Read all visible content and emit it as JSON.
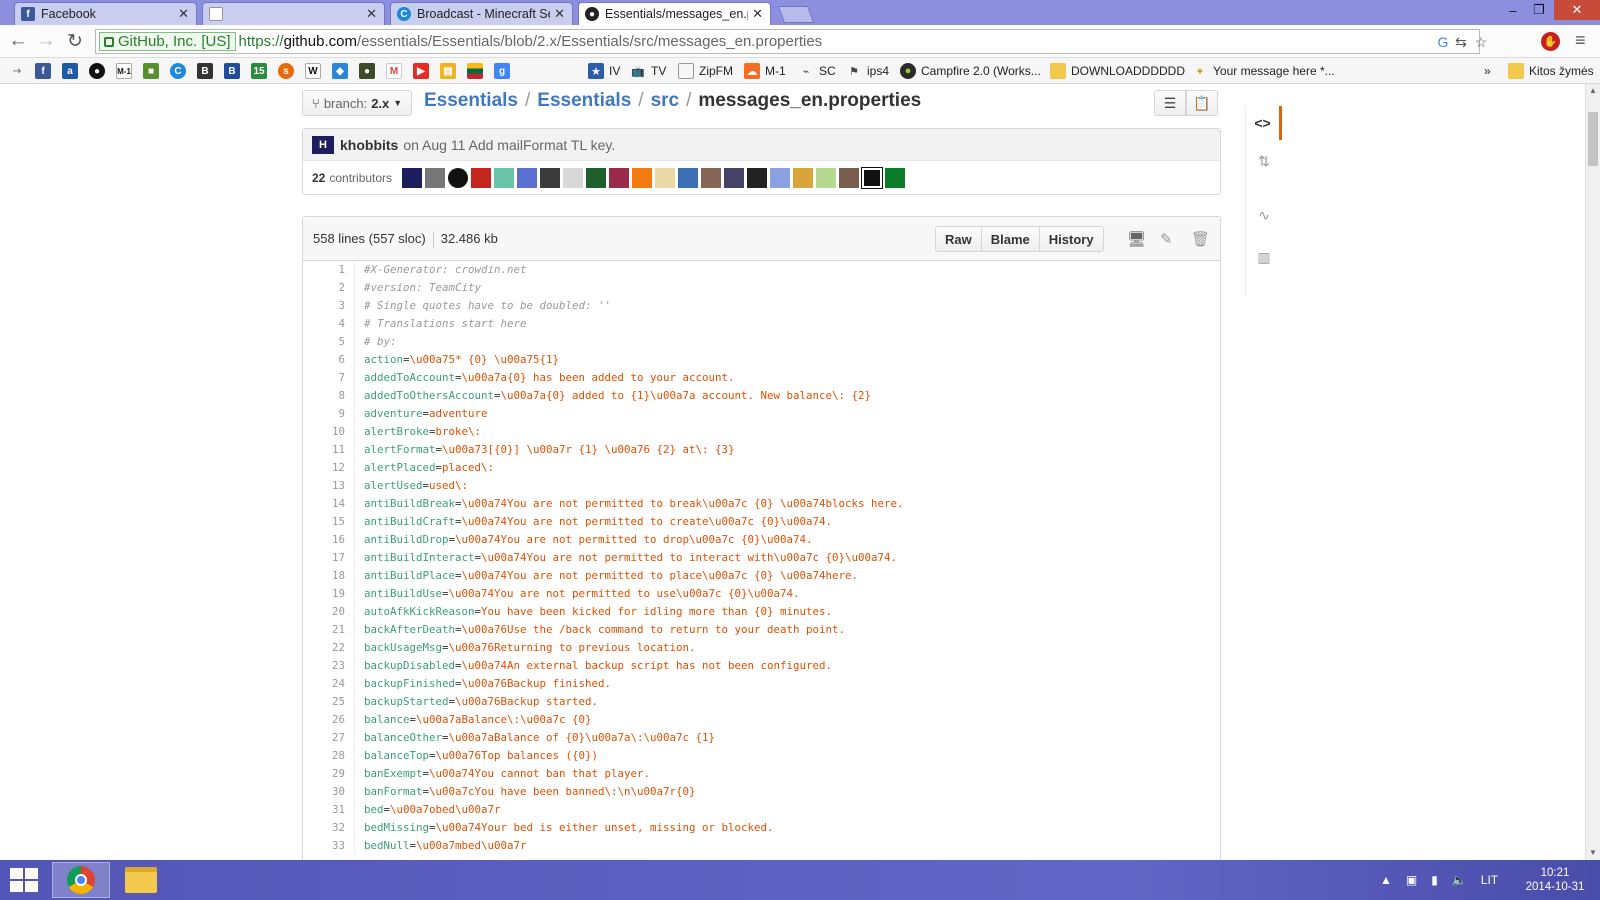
{
  "browser": {
    "tabs": [
      {
        "title": "Facebook",
        "icon": "facebook-icon",
        "color": "#3b5998"
      },
      {
        "title": "",
        "icon": "blank-page-icon",
        "color": "#cccccc"
      },
      {
        "title": "Broadcast - Minecraft Ser",
        "icon": "curse-icon",
        "color": "#1c8adb"
      },
      {
        "title": "Essentials/messages_en.pr",
        "icon": "github-icon",
        "color": "#222222"
      }
    ],
    "url": {
      "ev_label": "GitHub, Inc. [US]",
      "scheme": "https://",
      "host": "github.com",
      "path": "/essentials/Essentials/blob/2.x/Essentials/src/messages_en.properties"
    },
    "bookmarks": [
      {
        "label": "IV",
        "icon": "bookmark-site-icon"
      },
      {
        "label": "TV",
        "icon": "tv-icon"
      },
      {
        "label": "ZipFM",
        "icon": "page-icon"
      },
      {
        "label": "M-1",
        "icon": "soundcloud-icon"
      },
      {
        "label": "SC",
        "icon": "sc-icon"
      },
      {
        "label": "ips4",
        "icon": "ips-icon"
      },
      {
        "label": "Campfire 2.0 (Works...",
        "icon": "campfire-icon"
      },
      {
        "label": "DOWNLOADDDDDD",
        "icon": "folder-icon"
      },
      {
        "label": "Your message here *...",
        "icon": "pin-icon"
      }
    ],
    "bookmarks_more": "»",
    "other_bookmarks": "Kitos žymės"
  },
  "repo": {
    "branch_prefix": "branch:",
    "branch": "2.x",
    "breadcrumb": [
      "Essentials",
      "Essentials",
      "src"
    ],
    "filename": "messages_en.properties",
    "commit": {
      "author": "khobbits",
      "text": "on Aug 11 Add mailFormat TL key."
    },
    "contributors_count": "22",
    "contributors_label": "contributors",
    "file_meta": {
      "lines": "558 lines (557 sloc)",
      "size": "32.486 kb"
    },
    "buttons": {
      "raw": "Raw",
      "blame": "Blame",
      "history": "History"
    }
  },
  "code_lines": [
    {
      "n": "1",
      "c": "#X-Generator: crowdin.net"
    },
    {
      "n": "2",
      "c": "#version: TeamCity"
    },
    {
      "n": "3",
      "c": "# Single quotes have to be doubled: ''"
    },
    {
      "n": "4",
      "c": "# Translations start here"
    },
    {
      "n": "5",
      "c": "# by:"
    },
    {
      "n": "6",
      "k": "action",
      "v": "\\u00a75* {0} \\u00a75{1}"
    },
    {
      "n": "7",
      "k": "addedToAccount",
      "v": "\\u00a7a{0} has been added to your account."
    },
    {
      "n": "8",
      "k": "addedToOthersAccount",
      "v": "\\u00a7a{0} added to {1}\\u00a7a account. New balance\\: {2}"
    },
    {
      "n": "9",
      "k": "adventure",
      "v": "adventure"
    },
    {
      "n": "10",
      "k": "alertBroke",
      "v": "broke\\:"
    },
    {
      "n": "11",
      "k": "alertFormat",
      "v": "\\u00a73[{0}] \\u00a7r {1} \\u00a76 {2} at\\: {3}"
    },
    {
      "n": "12",
      "k": "alertPlaced",
      "v": "placed\\:"
    },
    {
      "n": "13",
      "k": "alertUsed",
      "v": "used\\:"
    },
    {
      "n": "14",
      "k": "antiBuildBreak",
      "v": "\\u00a74You are not permitted to break\\u00a7c {0} \\u00a74blocks here."
    },
    {
      "n": "15",
      "k": "antiBuildCraft",
      "v": "\\u00a74You are not permitted to create\\u00a7c {0}\\u00a74."
    },
    {
      "n": "16",
      "k": "antiBuildDrop",
      "v": "\\u00a74You are not permitted to drop\\u00a7c {0}\\u00a74."
    },
    {
      "n": "17",
      "k": "antiBuildInteract",
      "v": "\\u00a74You are not permitted to interact with\\u00a7c {0}\\u00a74."
    },
    {
      "n": "18",
      "k": "antiBuildPlace",
      "v": "\\u00a74You are not permitted to place\\u00a7c {0} \\u00a74here."
    },
    {
      "n": "19",
      "k": "antiBuildUse",
      "v": "\\u00a74You are not permitted to use\\u00a7c {0}\\u00a74."
    },
    {
      "n": "20",
      "k": "autoAfkKickReason",
      "v": "You have been kicked for idling more than {0} minutes."
    },
    {
      "n": "21",
      "k": "backAfterDeath",
      "v": "\\u00a76Use the /back command to return to your death point."
    },
    {
      "n": "22",
      "k": "backUsageMsg",
      "v": "\\u00a76Returning to previous location."
    },
    {
      "n": "23",
      "k": "backupDisabled",
      "v": "\\u00a74An external backup script has not been configured."
    },
    {
      "n": "24",
      "k": "backupFinished",
      "v": "\\u00a76Backup finished."
    },
    {
      "n": "25",
      "k": "backupStarted",
      "v": "\\u00a76Backup started."
    },
    {
      "n": "26",
      "k": "balance",
      "v": "\\u00a7aBalance\\:\\u00a7c {0}"
    },
    {
      "n": "27",
      "k": "balanceOther",
      "v": "\\u00a7aBalance of {0}\\u00a7a\\:\\u00a7c {1}"
    },
    {
      "n": "28",
      "k": "balanceTop",
      "v": "\\u00a76Top balances ({0})"
    },
    {
      "n": "29",
      "k": "banExempt",
      "v": "\\u00a74You cannot ban that player."
    },
    {
      "n": "30",
      "k": "banFormat",
      "v": "\\u00a7cYou have been banned\\:\\n\\u00a7r{0}"
    },
    {
      "n": "31",
      "k": "bed",
      "v": "\\u00a7obed\\u00a7r"
    },
    {
      "n": "32",
      "k": "bedMissing",
      "v": "\\u00a74Your bed is either unset, missing or blocked."
    },
    {
      "n": "33",
      "k": "bedNull",
      "v": "\\u00a7mbed\\u00a7r"
    }
  ],
  "taskbar": {
    "lang": "LIT",
    "time": "10:21",
    "date": "2014-10-31"
  },
  "colors": {
    "key": "#3a9f77",
    "value": "#df5000",
    "link": "#4078c0",
    "taskbar": "#5d60c0"
  }
}
